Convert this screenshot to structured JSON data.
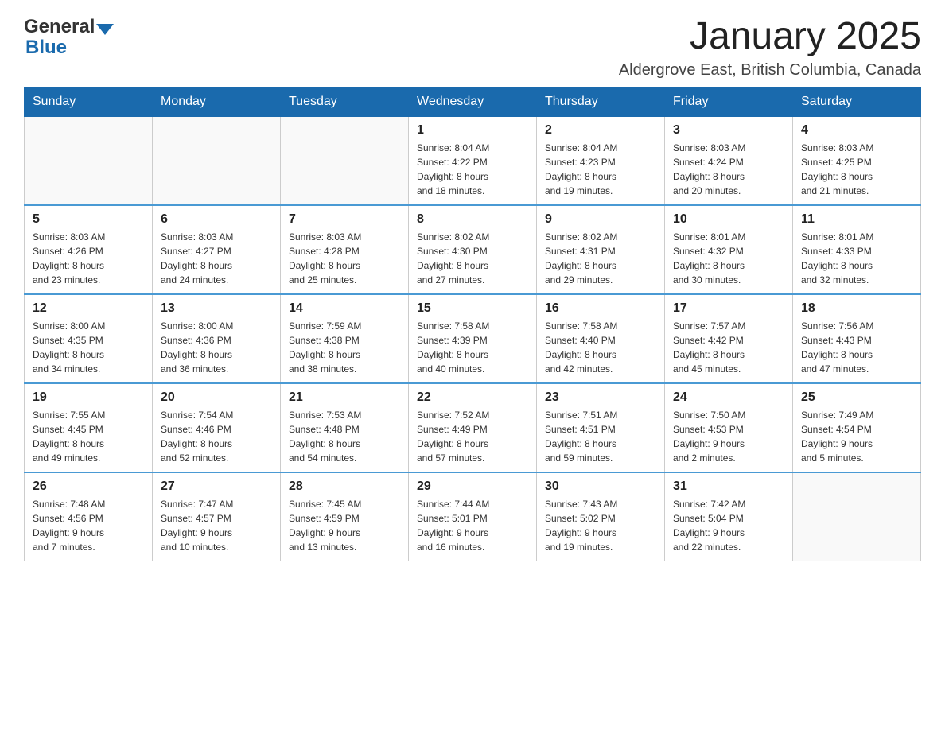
{
  "header": {
    "logo_general": "General",
    "logo_blue": "Blue",
    "month_title": "January 2025",
    "location": "Aldergrove East, British Columbia, Canada"
  },
  "days_of_week": [
    "Sunday",
    "Monday",
    "Tuesday",
    "Wednesday",
    "Thursday",
    "Friday",
    "Saturday"
  ],
  "weeks": [
    {
      "days": [
        {
          "number": "",
          "info": ""
        },
        {
          "number": "",
          "info": ""
        },
        {
          "number": "",
          "info": ""
        },
        {
          "number": "1",
          "info": "Sunrise: 8:04 AM\nSunset: 4:22 PM\nDaylight: 8 hours\nand 18 minutes."
        },
        {
          "number": "2",
          "info": "Sunrise: 8:04 AM\nSunset: 4:23 PM\nDaylight: 8 hours\nand 19 minutes."
        },
        {
          "number": "3",
          "info": "Sunrise: 8:03 AM\nSunset: 4:24 PM\nDaylight: 8 hours\nand 20 minutes."
        },
        {
          "number": "4",
          "info": "Sunrise: 8:03 AM\nSunset: 4:25 PM\nDaylight: 8 hours\nand 21 minutes."
        }
      ]
    },
    {
      "days": [
        {
          "number": "5",
          "info": "Sunrise: 8:03 AM\nSunset: 4:26 PM\nDaylight: 8 hours\nand 23 minutes."
        },
        {
          "number": "6",
          "info": "Sunrise: 8:03 AM\nSunset: 4:27 PM\nDaylight: 8 hours\nand 24 minutes."
        },
        {
          "number": "7",
          "info": "Sunrise: 8:03 AM\nSunset: 4:28 PM\nDaylight: 8 hours\nand 25 minutes."
        },
        {
          "number": "8",
          "info": "Sunrise: 8:02 AM\nSunset: 4:30 PM\nDaylight: 8 hours\nand 27 minutes."
        },
        {
          "number": "9",
          "info": "Sunrise: 8:02 AM\nSunset: 4:31 PM\nDaylight: 8 hours\nand 29 minutes."
        },
        {
          "number": "10",
          "info": "Sunrise: 8:01 AM\nSunset: 4:32 PM\nDaylight: 8 hours\nand 30 minutes."
        },
        {
          "number": "11",
          "info": "Sunrise: 8:01 AM\nSunset: 4:33 PM\nDaylight: 8 hours\nand 32 minutes."
        }
      ]
    },
    {
      "days": [
        {
          "number": "12",
          "info": "Sunrise: 8:00 AM\nSunset: 4:35 PM\nDaylight: 8 hours\nand 34 minutes."
        },
        {
          "number": "13",
          "info": "Sunrise: 8:00 AM\nSunset: 4:36 PM\nDaylight: 8 hours\nand 36 minutes."
        },
        {
          "number": "14",
          "info": "Sunrise: 7:59 AM\nSunset: 4:38 PM\nDaylight: 8 hours\nand 38 minutes."
        },
        {
          "number": "15",
          "info": "Sunrise: 7:58 AM\nSunset: 4:39 PM\nDaylight: 8 hours\nand 40 minutes."
        },
        {
          "number": "16",
          "info": "Sunrise: 7:58 AM\nSunset: 4:40 PM\nDaylight: 8 hours\nand 42 minutes."
        },
        {
          "number": "17",
          "info": "Sunrise: 7:57 AM\nSunset: 4:42 PM\nDaylight: 8 hours\nand 45 minutes."
        },
        {
          "number": "18",
          "info": "Sunrise: 7:56 AM\nSunset: 4:43 PM\nDaylight: 8 hours\nand 47 minutes."
        }
      ]
    },
    {
      "days": [
        {
          "number": "19",
          "info": "Sunrise: 7:55 AM\nSunset: 4:45 PM\nDaylight: 8 hours\nand 49 minutes."
        },
        {
          "number": "20",
          "info": "Sunrise: 7:54 AM\nSunset: 4:46 PM\nDaylight: 8 hours\nand 52 minutes."
        },
        {
          "number": "21",
          "info": "Sunrise: 7:53 AM\nSunset: 4:48 PM\nDaylight: 8 hours\nand 54 minutes."
        },
        {
          "number": "22",
          "info": "Sunrise: 7:52 AM\nSunset: 4:49 PM\nDaylight: 8 hours\nand 57 minutes."
        },
        {
          "number": "23",
          "info": "Sunrise: 7:51 AM\nSunset: 4:51 PM\nDaylight: 8 hours\nand 59 minutes."
        },
        {
          "number": "24",
          "info": "Sunrise: 7:50 AM\nSunset: 4:53 PM\nDaylight: 9 hours\nand 2 minutes."
        },
        {
          "number": "25",
          "info": "Sunrise: 7:49 AM\nSunset: 4:54 PM\nDaylight: 9 hours\nand 5 minutes."
        }
      ]
    },
    {
      "days": [
        {
          "number": "26",
          "info": "Sunrise: 7:48 AM\nSunset: 4:56 PM\nDaylight: 9 hours\nand 7 minutes."
        },
        {
          "number": "27",
          "info": "Sunrise: 7:47 AM\nSunset: 4:57 PM\nDaylight: 9 hours\nand 10 minutes."
        },
        {
          "number": "28",
          "info": "Sunrise: 7:45 AM\nSunset: 4:59 PM\nDaylight: 9 hours\nand 13 minutes."
        },
        {
          "number": "29",
          "info": "Sunrise: 7:44 AM\nSunset: 5:01 PM\nDaylight: 9 hours\nand 16 minutes."
        },
        {
          "number": "30",
          "info": "Sunrise: 7:43 AM\nSunset: 5:02 PM\nDaylight: 9 hours\nand 19 minutes."
        },
        {
          "number": "31",
          "info": "Sunrise: 7:42 AM\nSunset: 5:04 PM\nDaylight: 9 hours\nand 22 minutes."
        },
        {
          "number": "",
          "info": ""
        }
      ]
    }
  ]
}
